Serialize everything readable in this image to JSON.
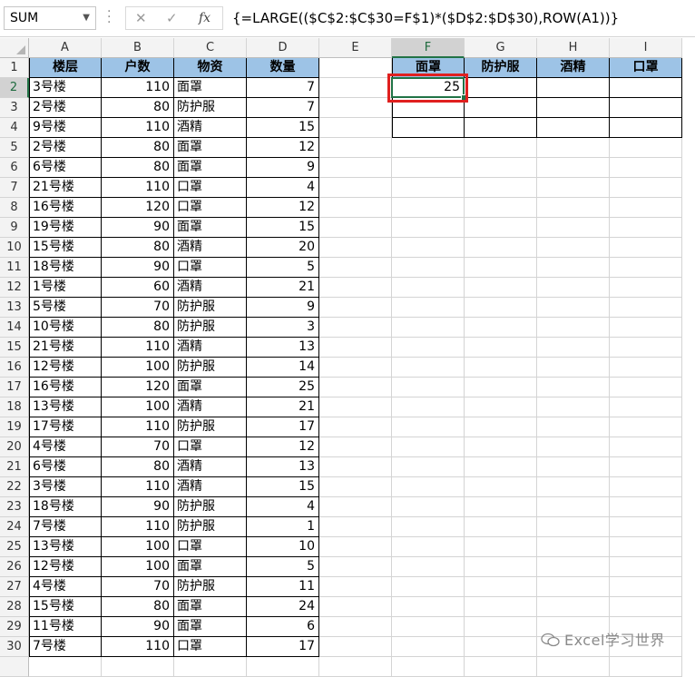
{
  "formula_bar": {
    "name_box": "SUM",
    "cancel_icon": "✕",
    "enter_icon": "✓",
    "fx_label": "fx",
    "formula": "{=LARGE(($C$2:$C$30=F$1)*($D$2:$D$30),ROW(A1))}"
  },
  "columns": [
    "A",
    "B",
    "C",
    "D",
    "E",
    "F",
    "G",
    "H",
    "I"
  ],
  "selected_column": "F",
  "selected_row": 2,
  "table": {
    "headers": [
      "楼层",
      "户数",
      "物资",
      "数量"
    ],
    "rows": [
      [
        "3号楼",
        "110",
        "面罩",
        "7"
      ],
      [
        "2号楼",
        "80",
        "防护服",
        "7"
      ],
      [
        "9号楼",
        "110",
        "酒精",
        "15"
      ],
      [
        "2号楼",
        "80",
        "面罩",
        "12"
      ],
      [
        "6号楼",
        "80",
        "面罩",
        "9"
      ],
      [
        "21号楼",
        "110",
        "口罩",
        "4"
      ],
      [
        "16号楼",
        "120",
        "口罩",
        "12"
      ],
      [
        "19号楼",
        "90",
        "面罩",
        "15"
      ],
      [
        "15号楼",
        "80",
        "酒精",
        "20"
      ],
      [
        "18号楼",
        "90",
        "口罩",
        "5"
      ],
      [
        "1号楼",
        "60",
        "酒精",
        "21"
      ],
      [
        "5号楼",
        "70",
        "防护服",
        "9"
      ],
      [
        "10号楼",
        "80",
        "防护服",
        "3"
      ],
      [
        "21号楼",
        "110",
        "酒精",
        "13"
      ],
      [
        "12号楼",
        "100",
        "防护服",
        "14"
      ],
      [
        "16号楼",
        "120",
        "面罩",
        "25"
      ],
      [
        "13号楼",
        "100",
        "酒精",
        "21"
      ],
      [
        "17号楼",
        "110",
        "防护服",
        "17"
      ],
      [
        "4号楼",
        "70",
        "口罩",
        "12"
      ],
      [
        "6号楼",
        "80",
        "酒精",
        "13"
      ],
      [
        "3号楼",
        "110",
        "酒精",
        "15"
      ],
      [
        "18号楼",
        "90",
        "防护服",
        "4"
      ],
      [
        "7号楼",
        "110",
        "防护服",
        "1"
      ],
      [
        "13号楼",
        "100",
        "口罩",
        "10"
      ],
      [
        "12号楼",
        "100",
        "面罩",
        "5"
      ],
      [
        "4号楼",
        "70",
        "防护服",
        "11"
      ],
      [
        "15号楼",
        "80",
        "面罩",
        "24"
      ],
      [
        "11号楼",
        "90",
        "面罩",
        "6"
      ],
      [
        "7号楼",
        "110",
        "口罩",
        "17"
      ]
    ]
  },
  "result": {
    "headers": [
      "面罩",
      "防护服",
      "酒精",
      "口罩"
    ],
    "rows": [
      [
        "25",
        "",
        "",
        ""
      ],
      [
        "",
        "",
        "",
        ""
      ],
      [
        "",
        "",
        "",
        ""
      ]
    ]
  },
  "watermark": "Excel学习世界",
  "colors": {
    "header_fill": "#9dc3e6",
    "selection": "#217346",
    "highlight": "#e0201f"
  }
}
